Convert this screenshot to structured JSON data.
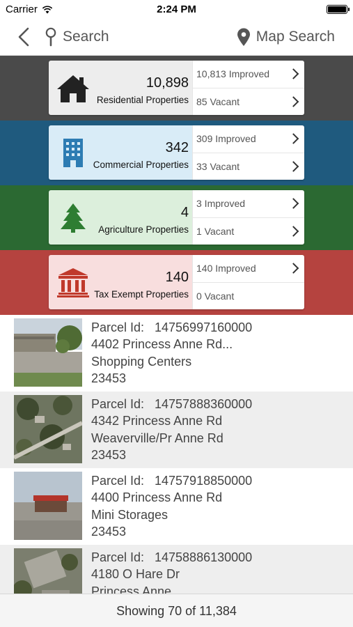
{
  "status_bar": {
    "carrier": "Carrier",
    "time": "2:24 PM"
  },
  "nav": {
    "search_label": "Search",
    "map_search_label": "Map Search"
  },
  "colors": {
    "residential_band": "#4a4a4a",
    "residential_card": "#ededed",
    "commercial_band": "#1f5a7e",
    "commercial_card": "#d9ecf7",
    "agriculture_band": "#2b6932",
    "agriculture_card": "#dcefdc",
    "exempt_band": "#b5433f",
    "exempt_card": "#f8dede"
  },
  "categories": [
    {
      "icon": "house-icon",
      "count": "10,898",
      "label": "Residential Properties",
      "improved": "10,813 Improved",
      "vacant": "85 Vacant"
    },
    {
      "icon": "office-building-icon",
      "count": "342",
      "label": "Commercial Properties",
      "improved": "309 Improved",
      "vacant": "33 Vacant"
    },
    {
      "icon": "pine-tree-icon",
      "count": "4",
      "label": "Agriculture Properties",
      "improved": "3 Improved",
      "vacant": "1 Vacant"
    },
    {
      "icon": "bank-columns-icon",
      "count": "140",
      "label": "Tax Exempt Properties",
      "improved": "140 Improved",
      "vacant": "0 Vacant"
    }
  ],
  "parcel_id_label": "Parcel Id:",
  "parcels": [
    {
      "id": "14756997160000",
      "address": "4402 Princess Anne Rd...",
      "use": "Shopping Centers",
      "zip": "23453"
    },
    {
      "id": "14757888360000",
      "address": "4342 Princess Anne Rd",
      "use": "Weaverville/Pr Anne Rd",
      "zip": "23453"
    },
    {
      "id": "14757918850000",
      "address": "4400 Princess Anne Rd",
      "use": "Mini Storages",
      "zip": "23453"
    },
    {
      "id": "14758886130000",
      "address": "4180 O Hare Dr",
      "use": "Princess Anne",
      "zip": ""
    }
  ],
  "footer": {
    "showing": "Showing 70 of 11,384"
  }
}
